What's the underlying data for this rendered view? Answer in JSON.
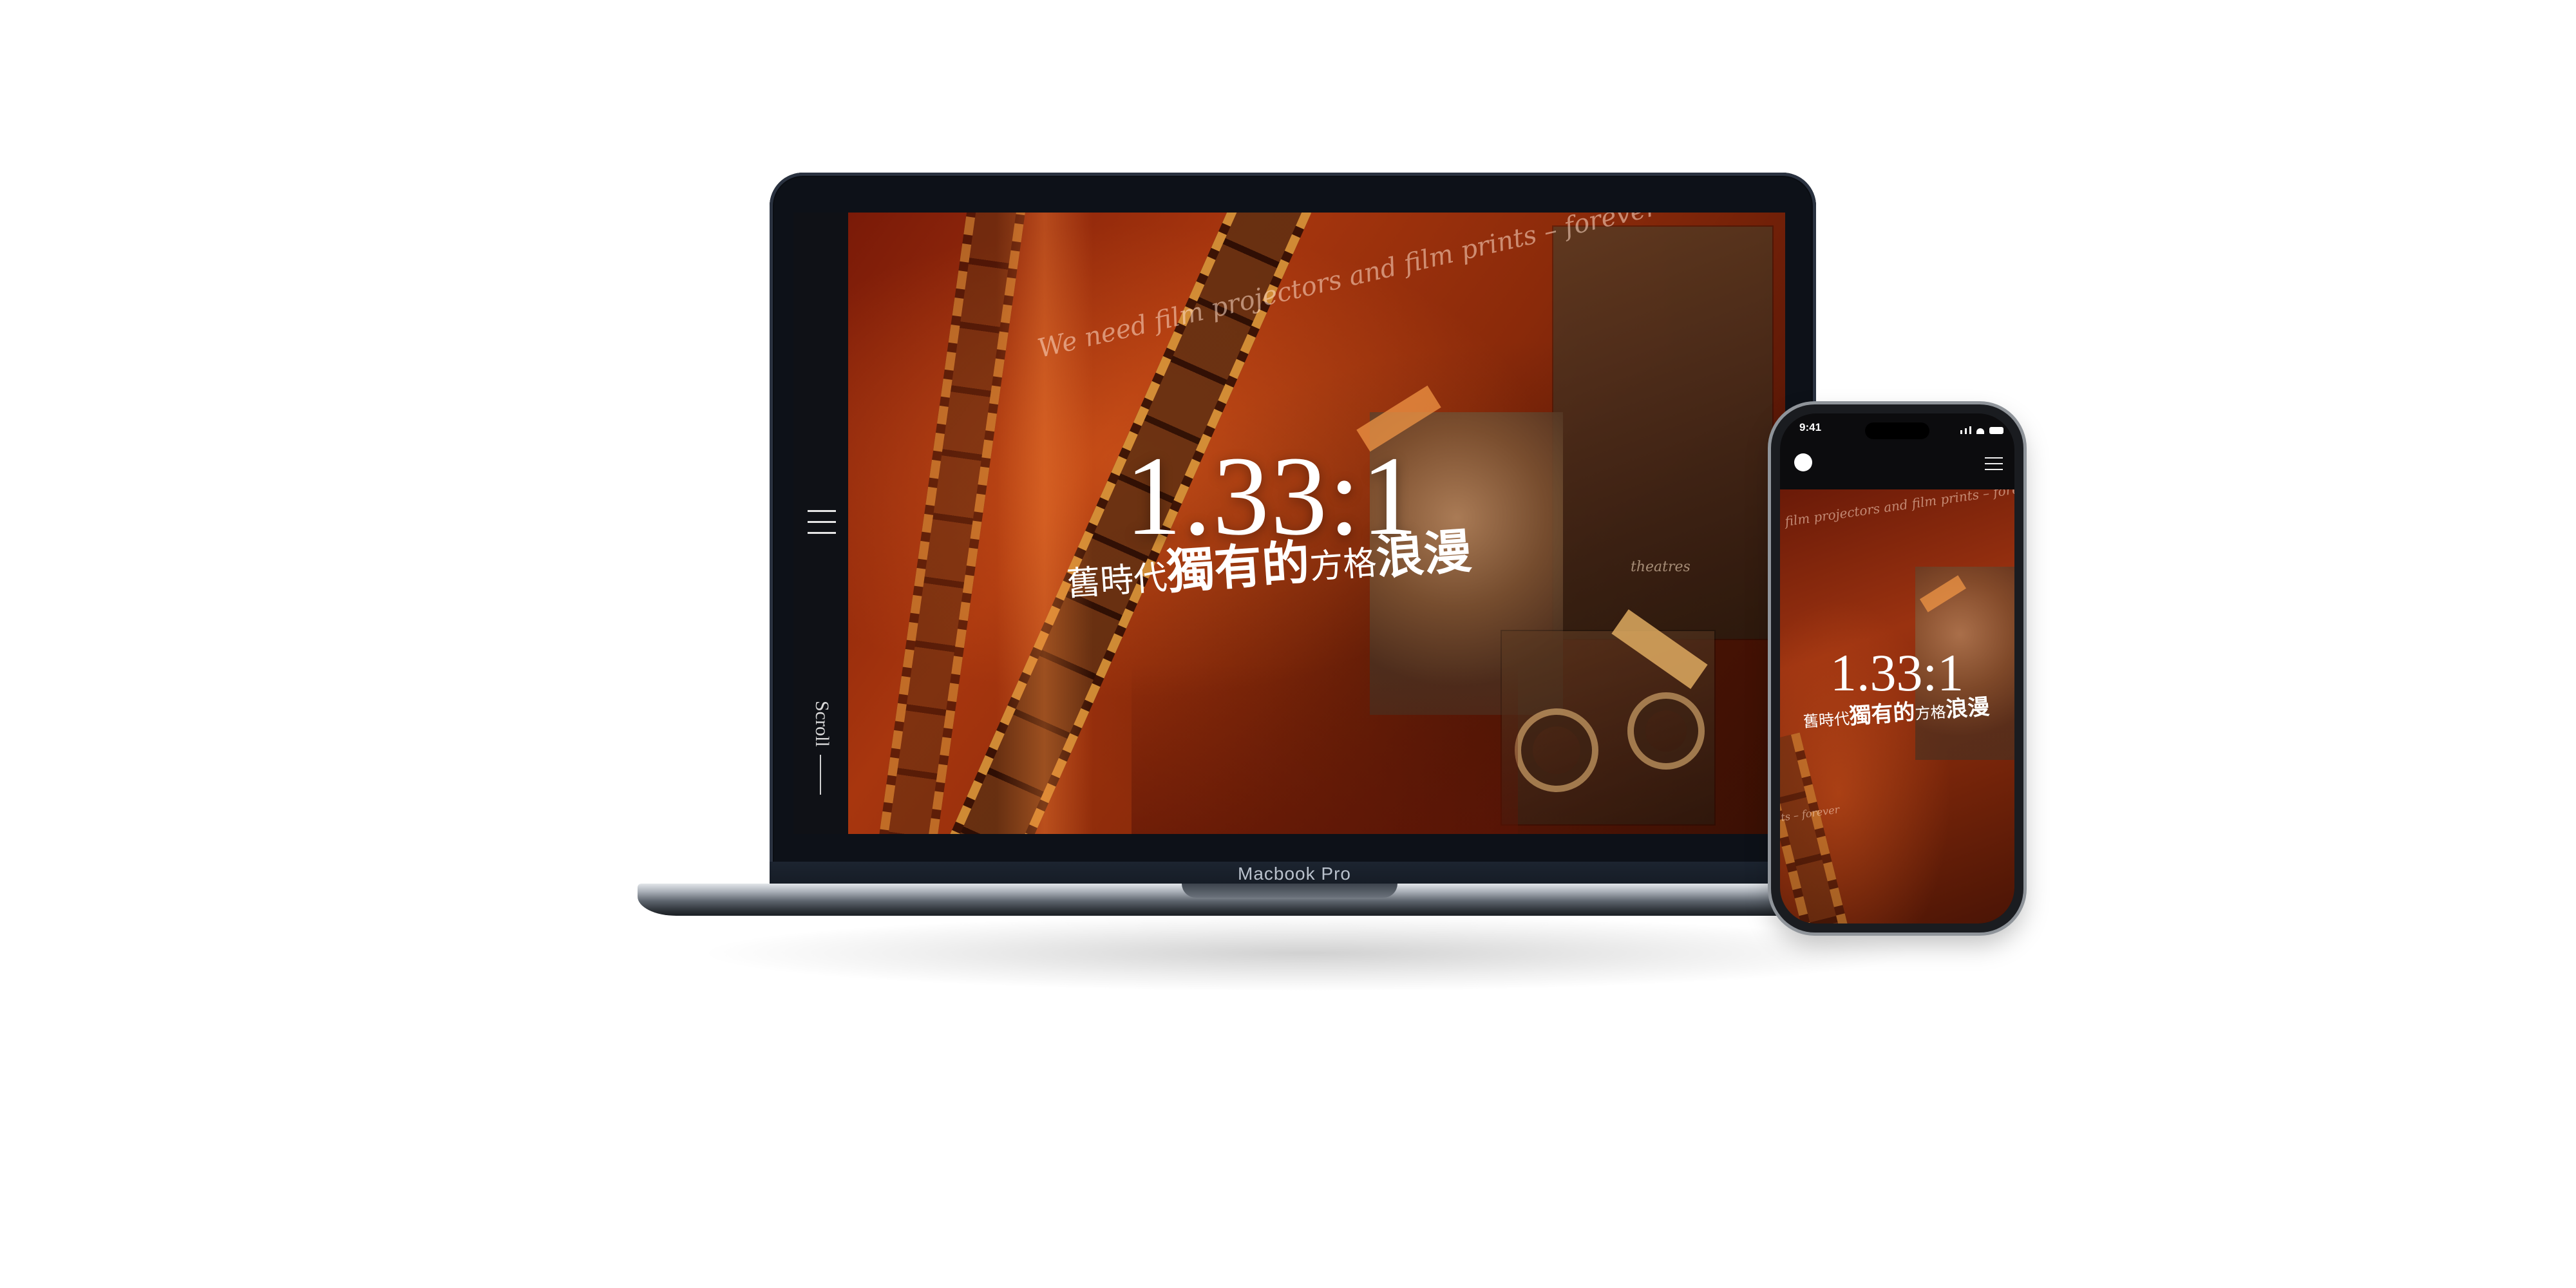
{
  "laptop": {
    "model_label": "Macbook Pro",
    "site": {
      "hero": {
        "script_text": "We need film projectors and film prints – forever",
        "ratio": "1.33:1",
        "tagline_parts": [
          "舊時代",
          "獨有的",
          "方格",
          "浪漫"
        ],
        "tape_word": "theatres"
      },
      "scroll_label": "Scroll"
    }
  },
  "phone": {
    "status_time": "9:41",
    "hero": {
      "script_text": "film projectors and film prints – forever",
      "ratio": "1.33:1",
      "tagline_parts": [
        "舊時代",
        "獨有的",
        "方格",
        "浪漫"
      ],
      "script_bottom": "ts – forever"
    }
  }
}
